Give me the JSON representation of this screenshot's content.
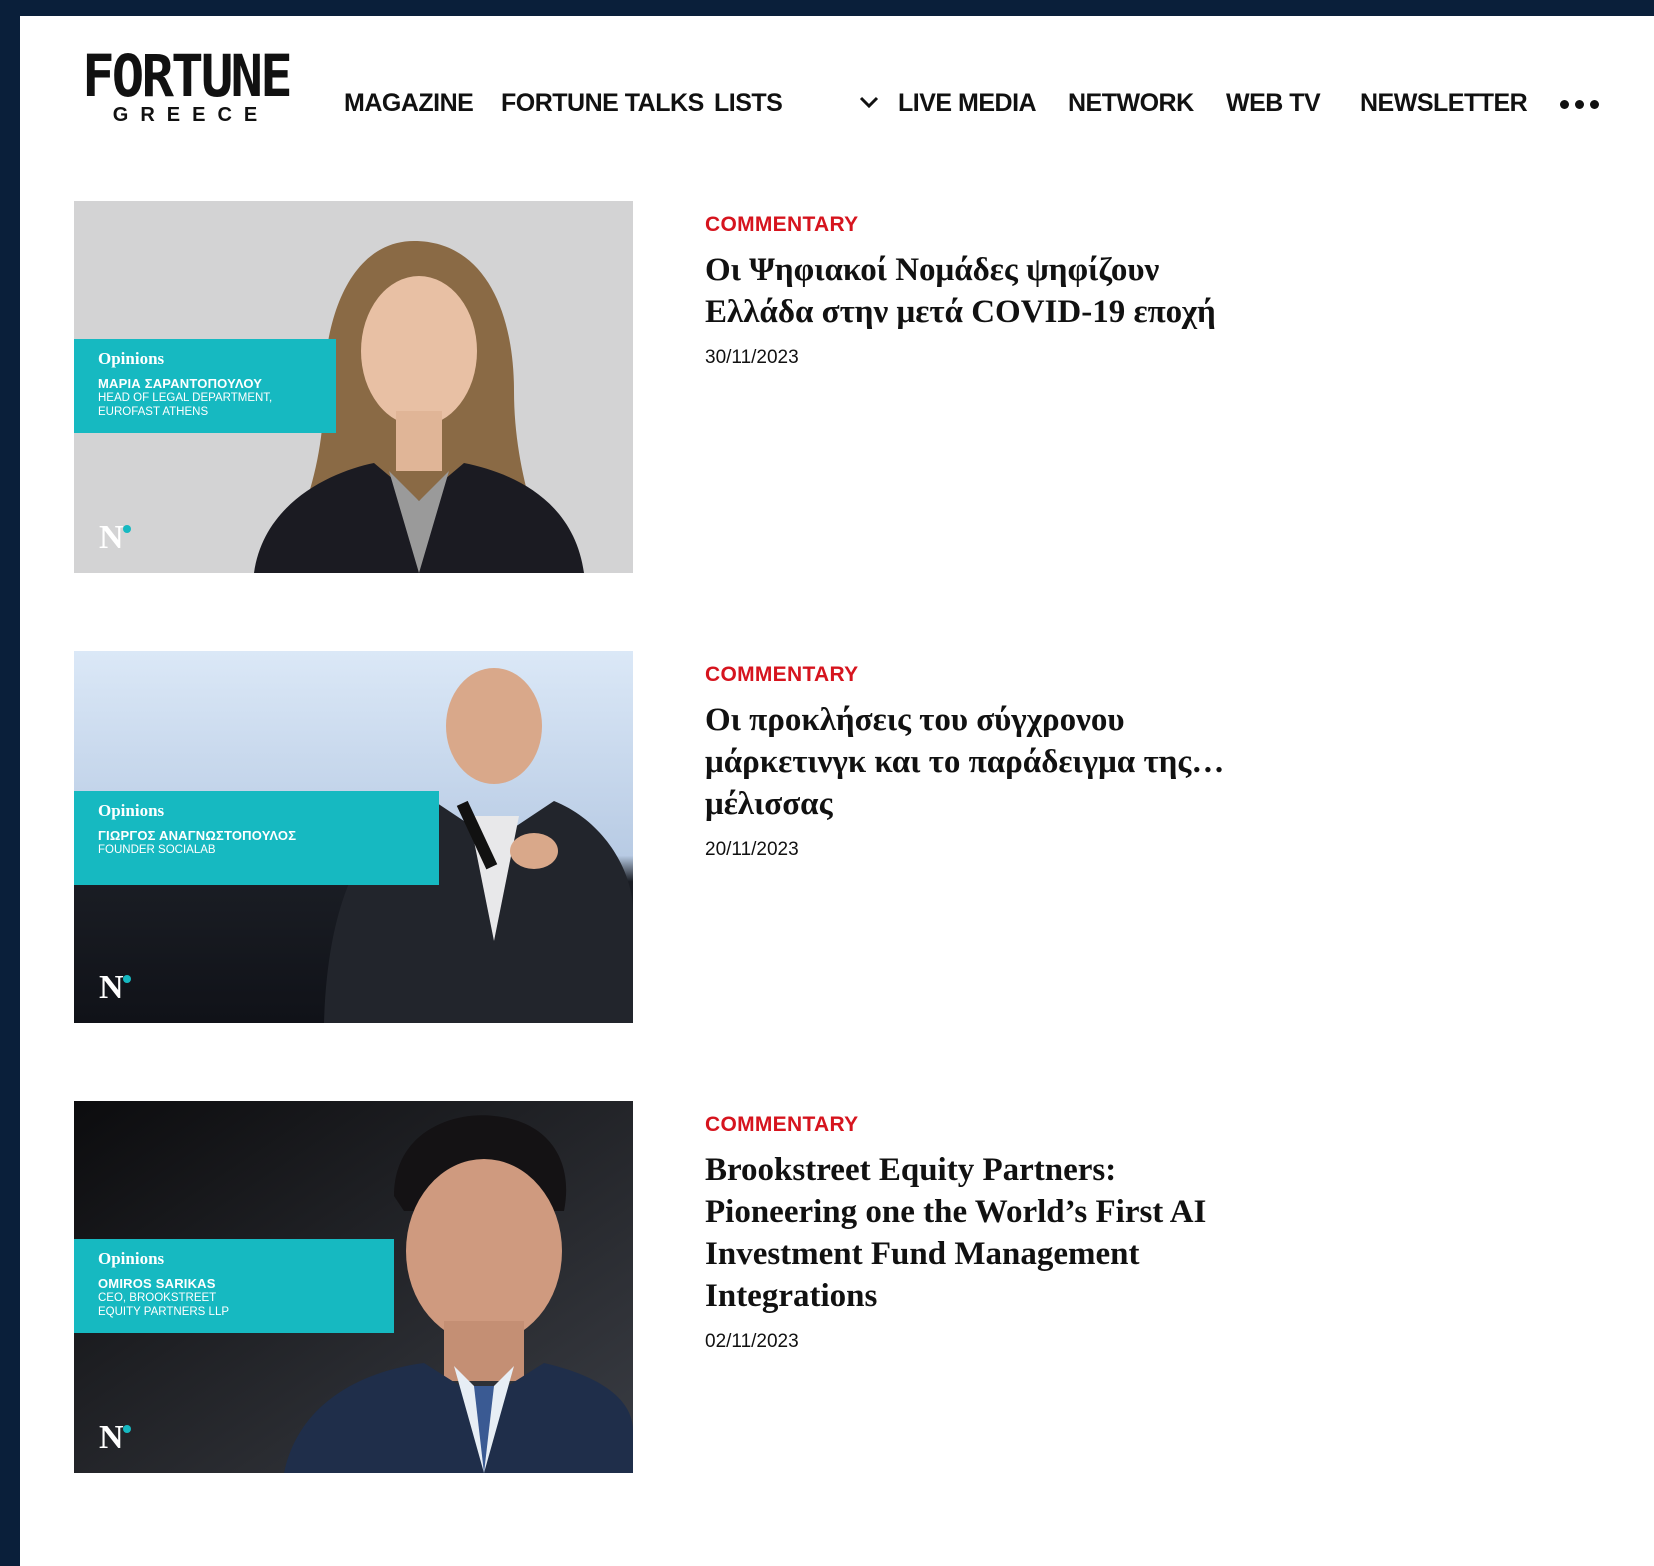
{
  "brand": {
    "name": "FORTUNE",
    "sub": "GREECE"
  },
  "nav": {
    "items": [
      "MAGAZINE",
      "FORTUNE TALKS",
      "LISTS",
      "LIVE MEDIA",
      "NETWORK",
      "WEB TV",
      "NEWSLETTER"
    ],
    "lists_has_dropdown": true,
    "more_icon": "more-dots-icon"
  },
  "colors": {
    "frame": "#0a1f3a",
    "accent": "#d6141e",
    "teal": "#16b9c1"
  },
  "articles": [
    {
      "category": "COMMENTARY",
      "title": "Οι Ψηφιακοί Νομάδες ψηφίζουν Ελλάδα στην μετά COVID-19 εποχή",
      "date": "30/11/2023",
      "image": {
        "label": "Opinions",
        "name": "ΜΑΡΙΑ ΣΑΡΑΝΤΟΠΟΥΛΟΥ",
        "role": "HEAD OF LEGAL DEPARTMENT, EUROFAST ATHENS"
      }
    },
    {
      "category": "COMMENTARY",
      "title": "Οι προκλήσεις του σύγχρονου μάρκετινγκ και το παράδειγμα της… μέλισσας",
      "date": "20/11/2023",
      "image": {
        "label": "Opinions",
        "name": "ΓΙΩΡΓΟΣ ΑΝΑΓΝΩΣΤΟΠΟΥΛΟΣ",
        "role": "FOUNDER SOCIALAB"
      }
    },
    {
      "category": "COMMENTARY",
      "title": "Brookstreet Equity Partners: Pioneering one the World’s First AI Investment Fund Management Integrations",
      "date": "02/11/2023",
      "image": {
        "label": "Opinions",
        "name": "OMIROS SARIKAS",
        "role": "CEO, BROOKSTREET EQUITY PARTNERS LLP"
      }
    }
  ]
}
